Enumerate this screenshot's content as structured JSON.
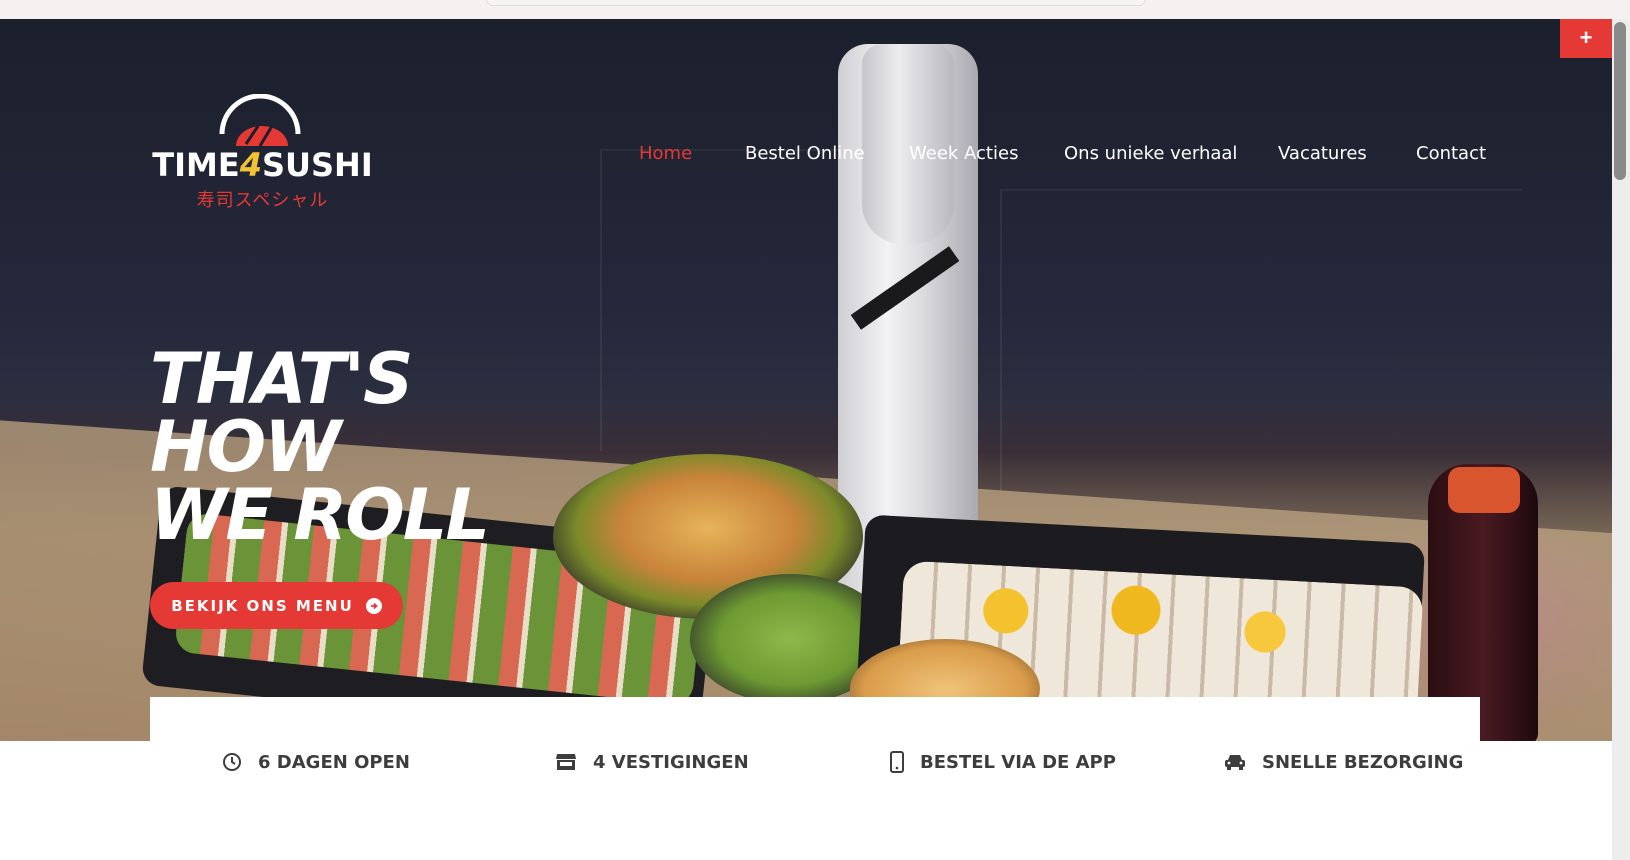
{
  "brand": {
    "name_part1": "TIME",
    "name_four": "4",
    "name_part2": "SUSHI",
    "tagline_jp": "寿司スペシャル"
  },
  "nav": {
    "items": [
      {
        "label": "Home",
        "active": true
      },
      {
        "label": "Bestel Online",
        "active": false
      },
      {
        "label": "Week Acties",
        "active": false
      },
      {
        "label": "Ons unieke verhaal",
        "active": false
      },
      {
        "label": "Vacatures",
        "active": false
      },
      {
        "label": "Contact",
        "active": false
      }
    ]
  },
  "floating_button": {
    "label": "+"
  },
  "hero": {
    "headline_line1": "THAT'S HOW",
    "headline_line2": "WE ROLL",
    "cta_label": "BEKIJK ONS MENU"
  },
  "features": [
    {
      "icon": "clock-icon",
      "label": "6 DAGEN OPEN"
    },
    {
      "icon": "store-icon",
      "label": "4 VESTIGINGEN"
    },
    {
      "icon": "phone-icon",
      "label": "BESTEL VIA DE APP"
    },
    {
      "icon": "car-icon",
      "label": "SNELLE BEZORGING"
    }
  ],
  "colors": {
    "accent": "#e53935",
    "nav_text": "#ffffff",
    "feature_text": "#3d3d3d",
    "logo_four": "#f1c232"
  }
}
